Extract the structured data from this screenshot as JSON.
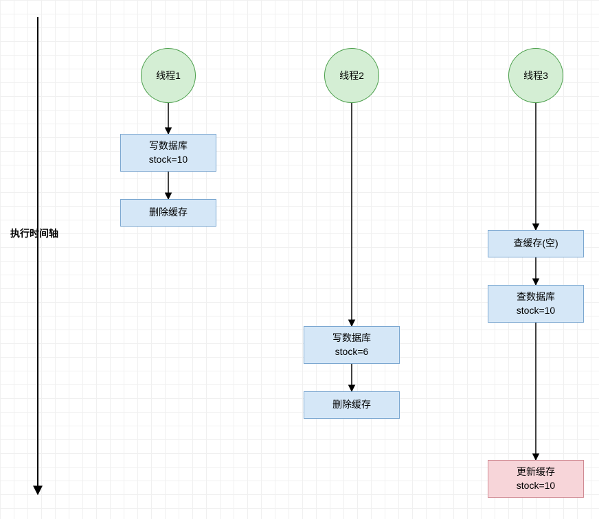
{
  "timeline": {
    "label": "执行时间轴"
  },
  "threads": [
    {
      "circle": {
        "label": "线程1"
      },
      "nodes": [
        {
          "line1": "写数据库",
          "line2": "stock=10",
          "style": "blue"
        },
        {
          "line1": "删除缓存",
          "line2": "",
          "style": "blue"
        }
      ]
    },
    {
      "circle": {
        "label": "线程2"
      },
      "nodes": [
        {
          "line1": "写数据库",
          "line2": "stock=6",
          "style": "blue"
        },
        {
          "line1": "删除缓存",
          "line2": "",
          "style": "blue"
        }
      ]
    },
    {
      "circle": {
        "label": "线程3"
      },
      "nodes": [
        {
          "line1": "查缓存(空)",
          "line2": "",
          "style": "blue"
        },
        {
          "line1": "查数据库",
          "line2": "stock=10",
          "style": "blue"
        },
        {
          "line1": "更新缓存",
          "line2": "stock=10",
          "style": "pink"
        }
      ]
    }
  ]
}
